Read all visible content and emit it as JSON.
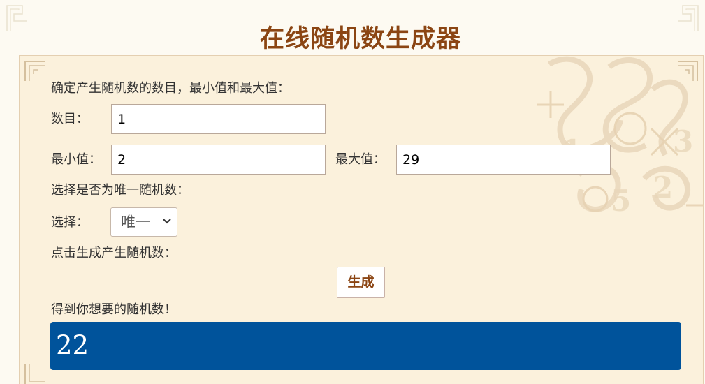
{
  "title": "在线随机数生成器",
  "instructions": {
    "setup": "确定产生随机数的数目，最小值和最大值：",
    "unique": "选择是否为唯一随机数：",
    "generate": "点击生成产生随机数：",
    "result": "得到你想要的随机数！"
  },
  "fields": {
    "count": {
      "label": "数目：",
      "value": "1"
    },
    "min": {
      "label": "最小值：",
      "value": "2"
    },
    "max": {
      "label": "最大值：",
      "value": "29"
    }
  },
  "selection": {
    "label": "选择：",
    "selected_value": "唯一"
  },
  "generate_button": {
    "label": "生成"
  },
  "result": {
    "value": "22"
  },
  "colors": {
    "title": "#8b4513",
    "panel_background": "#fbf1dc",
    "result_background": "#00539b",
    "button_text": "#8b4513"
  },
  "icons": {
    "select_arrow": "chevron-down-icon",
    "corner_ornament": "corner-ornament-icon",
    "background_decoration": "number-watermark"
  }
}
